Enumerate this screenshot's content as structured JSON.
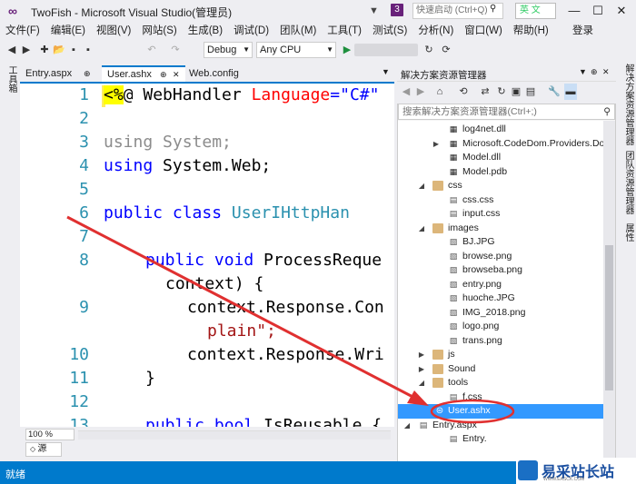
{
  "window": {
    "title": "TwoFish - Microsoft Visual Studio(管理员)",
    "notif_count": "3",
    "quick_launch_placeholder": "快速启动 (Ctrl+Q)",
    "ime_text": "英 文",
    "min": "—",
    "max": "☐",
    "close": "✕"
  },
  "menu": {
    "items": [
      "文件(F)",
      "编辑(E)",
      "视图(V)",
      "网站(S)",
      "生成(B)",
      "调试(D)",
      "团队(M)",
      "工具(T)",
      "测试(S)",
      "分析(N)",
      "窗口(W)",
      "帮助(H)"
    ],
    "login": "登录"
  },
  "toolbar": {
    "config": "Debug",
    "platform": "Any CPU"
  },
  "left_strip": {
    "label": "工具箱"
  },
  "tabs": [
    {
      "label": "Entry.aspx"
    },
    {
      "label": "User.ashx",
      "active": true
    },
    {
      "label": "Web.config"
    }
  ],
  "editor": {
    "line_numbers": [
      "1",
      "2",
      "3",
      "4",
      "5",
      "6",
      "7",
      "8",
      "",
      "9",
      "",
      "10",
      "11",
      "12",
      "13"
    ],
    "l1a": "<%",
    "l1b": "@ WebHandler ",
    "l1c": "Language",
    "l1d": "=",
    "l1e": "\"C#\"",
    "l3a": "using ",
    "l3b": "System;",
    "l4a": "using ",
    "l4b": "System.Web;",
    "l6a": "public class ",
    "l6b": "User",
    " l6c": " : ",
    "l6d": "IHttpHan",
    "l8a": "public void ",
    "l8b": "ProcessReque",
    "l8c": "context) {",
    "l9a": "context.Response.Con",
    "l9b": "plain",
    "l9c": "\";",
    "l10": "context.Response.Wri",
    "l11": "}",
    "l13a": "public bool ",
    "l13b": "IsReusable {"
  },
  "zoom": "100 %",
  "source_tab": "源",
  "solution_explorer": {
    "title": "解决方案资源管理器",
    "search_placeholder": "搜索解决方案资源管理器(Ctrl+;)",
    "nodes": [
      {
        "label": "log4net.dll",
        "icon": "dll-icon"
      },
      {
        "label": "Microsoft.CodeDom.Providers.Do",
        "icon": "dll-icon"
      },
      {
        "label": "Model.dll",
        "icon": "dll-icon"
      },
      {
        "label": "Model.pdb",
        "icon": "pdb-icon"
      },
      {
        "label": "css",
        "icon": "folder-icon"
      },
      {
        "label": "css.css",
        "icon": "css-file-icon"
      },
      {
        "label": "input.css",
        "icon": "css-file-icon"
      },
      {
        "label": "images",
        "icon": "folder-icon"
      },
      {
        "label": "BJ.JPG",
        "icon": "image-file-icon"
      },
      {
        "label": "browse.png",
        "icon": "image-file-icon"
      },
      {
        "label": "browseba.png",
        "icon": "image-file-icon"
      },
      {
        "label": "entry.png",
        "icon": "image-file-icon"
      },
      {
        "label": "huoche.JPG",
        "icon": "image-file-icon"
      },
      {
        "label": "IMG_2018.png",
        "icon": "image-file-icon"
      },
      {
        "label": "logo.png",
        "icon": "image-file-icon"
      },
      {
        "label": "trans.png",
        "icon": "image-file-icon"
      },
      {
        "label": "js",
        "icon": "folder-icon"
      },
      {
        "label": "Sound",
        "icon": "folder-icon"
      },
      {
        "label": "tools",
        "icon": "folder-icon"
      },
      {
        "label": "f.css",
        "icon": "css-file-icon"
      },
      {
        "label": "User.ashx",
        "icon": "ashx-file-icon"
      },
      {
        "label": "Entry.aspx",
        "icon": "aspx-file-icon"
      },
      {
        "label": "Entry.",
        "icon": "cs-file-icon"
      }
    ]
  },
  "right_strip": {
    "labels": [
      "解决方案资源管理器",
      "团队资源管理器",
      "属性"
    ]
  },
  "status": {
    "text": "就绪"
  },
  "watermark": {
    "text": "易采站长站",
    "sub": "WWW.EASCK.COM"
  }
}
